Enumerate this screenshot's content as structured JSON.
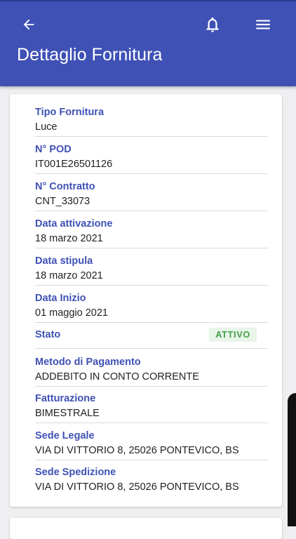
{
  "header": {
    "title": "Dettaglio Fornitura",
    "background_color": "#3f51b5",
    "icons": {
      "back": "arrow-left-icon",
      "notifications": "bell-icon",
      "menu": "hamburger-menu-icon"
    }
  },
  "details": {
    "tipo_fornitura": {
      "label": "Tipo Fornitura",
      "value": "Luce"
    },
    "pod": {
      "label": "N° POD",
      "value": "IT001E26501126"
    },
    "contratto": {
      "label": "N° Contratto",
      "value": "CNT_33073"
    },
    "data_attivazione": {
      "label": "Data attivazione",
      "value": "18 marzo 2021"
    },
    "data_stipula": {
      "label": "Data stipula",
      "value": "18 marzo 2021"
    },
    "data_inizio": {
      "label": "Data Inizio",
      "value": "01 maggio 2021"
    },
    "stato": {
      "label": "Stato",
      "badge": "ATTIVO",
      "badge_color": "#43a047"
    },
    "metodo_pagamento": {
      "label": "Metodo di Pagamento",
      "value": "ADDEBITO IN CONTO CORRENTE"
    },
    "fatturazione": {
      "label": "Fatturazione",
      "value": "BIMESTRALE"
    },
    "sede_legale": {
      "label": "Sede Legale",
      "value": "VIA DI VITTORIO 8, 25026 PONTEVICO, BS"
    },
    "sede_spedizione": {
      "label": "Sede Spedizione",
      "value": "VIA DI VITTORIO 8, 25026 PONTEVICO, BS"
    }
  },
  "colors": {
    "label": "#3f51b5",
    "value": "#222222",
    "page_background": "#efeff1"
  }
}
